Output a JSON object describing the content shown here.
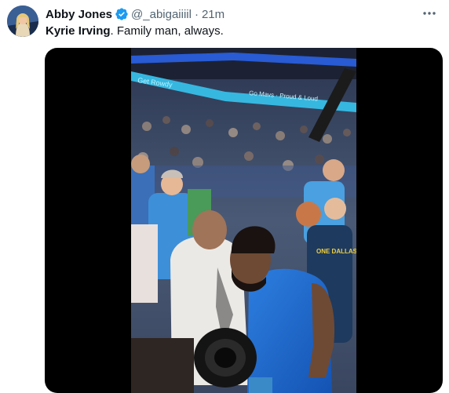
{
  "tweet": {
    "author_name": "Abby Jones",
    "author_handle": "@_abigaiiiil",
    "separator": "·",
    "time": "21m",
    "mention": "Kyrie Irving",
    "text_rest": ". Family man, always."
  },
  "video": {
    "banner_top": "Get Rowdy",
    "banner_right": "Go Mavs · Proud & Loud",
    "shirt_text": "ONE DALLAS",
    "brand_colors": {
      "mavs_blue": "#1c6fd1",
      "banner_teal": "#3fd6e6"
    }
  },
  "icons": {
    "verified": "verified-badge-icon",
    "more": "more-options-icon"
  },
  "colors": {
    "verified": "#1d9bf0",
    "secondary_text": "#536471",
    "text": "#0f1419"
  }
}
